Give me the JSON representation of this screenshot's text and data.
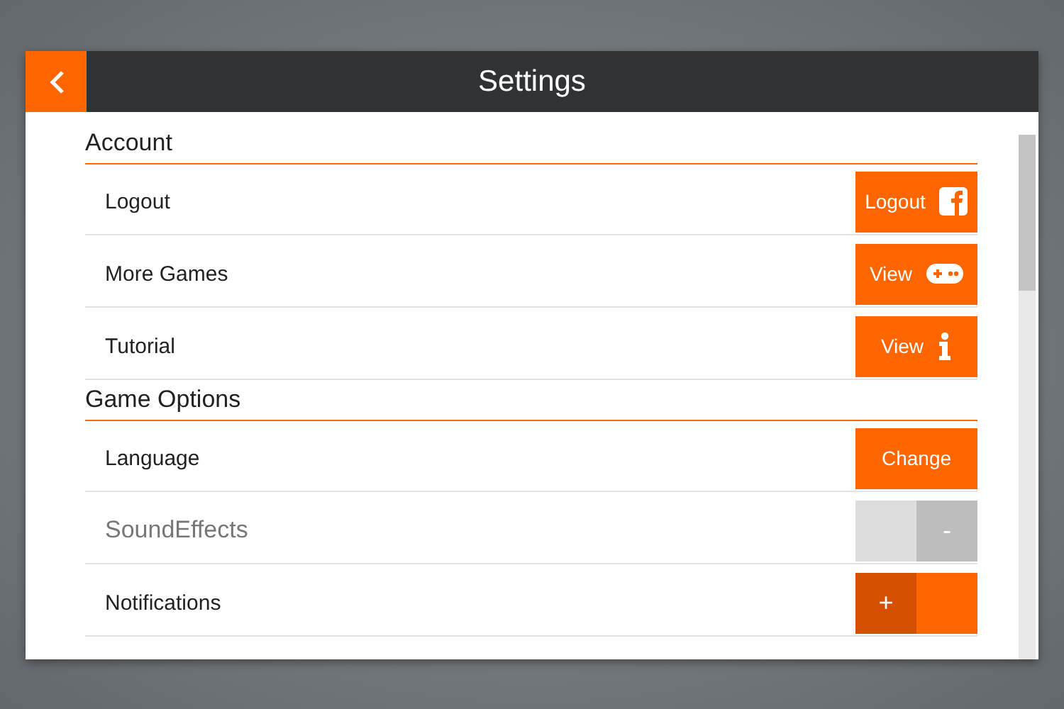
{
  "window": {
    "title": "Settings"
  },
  "sections": [
    {
      "title": "Account",
      "rows": [
        {
          "label": "Logout",
          "kind": "facebook",
          "button": "Logout"
        },
        {
          "label": "More Games",
          "kind": "gamepad",
          "button": "View"
        },
        {
          "label": "Tutorial",
          "kind": "info",
          "button": "View"
        }
      ]
    },
    {
      "title": "Game Options",
      "rows": [
        {
          "label": "Language",
          "kind": "text",
          "button": "Change"
        },
        {
          "label": "SoundEffects",
          "kind": "toggle",
          "on": false,
          "sign": "-"
        },
        {
          "label": "Notifications",
          "kind": "toggle",
          "on": true,
          "sign": "+"
        }
      ]
    }
  ]
}
